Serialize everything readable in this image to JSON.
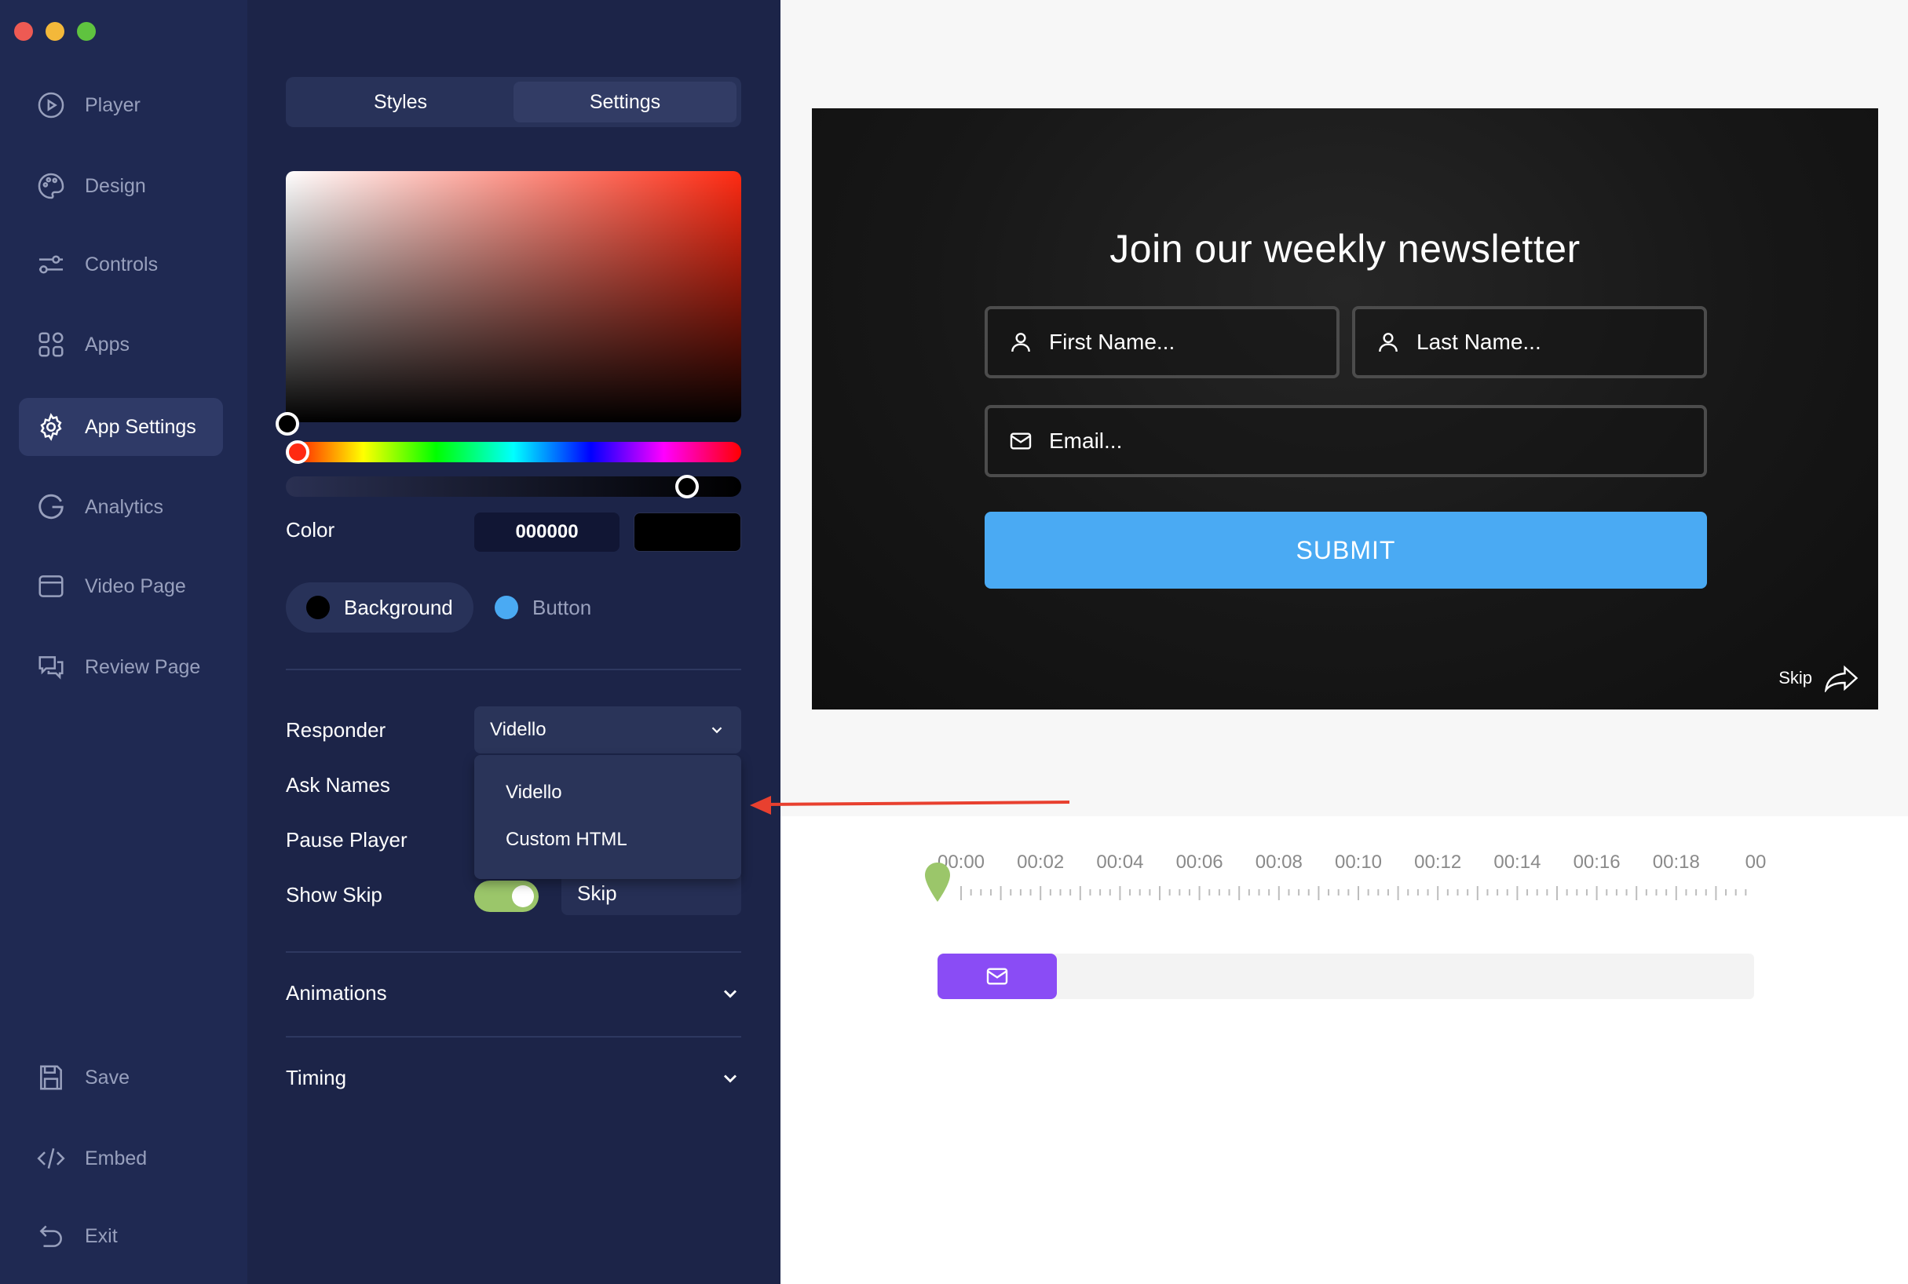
{
  "window": {
    "traffic_lights": [
      "#ee5a53",
      "#f3b83a",
      "#5fc33f"
    ]
  },
  "nav": {
    "items": [
      {
        "label": "Player",
        "icon": "play-circle-icon"
      },
      {
        "label": "Design",
        "icon": "palette-icon"
      },
      {
        "label": "Controls",
        "icon": "sliders-icon"
      },
      {
        "label": "Apps",
        "icon": "apps-grid-icon"
      },
      {
        "label": "App Settings",
        "icon": "gear-icon",
        "active": true
      },
      {
        "label": "Analytics",
        "icon": "analytics-g-icon"
      },
      {
        "label": "Video Page",
        "icon": "browser-window-icon"
      },
      {
        "label": "Review Page",
        "icon": "chat-bubbles-icon"
      }
    ],
    "bottom": [
      {
        "label": "Save",
        "icon": "floppy-disk-icon"
      },
      {
        "label": "Embed",
        "icon": "code-icon"
      },
      {
        "label": "Exit",
        "icon": "undo-arrow-icon"
      }
    ]
  },
  "panel": {
    "tabs": {
      "styles": "Styles",
      "settings": "Settings",
      "active": "settings"
    },
    "picker": {
      "hue_color": "#ff2a12"
    },
    "color": {
      "label": "Color",
      "hex": "000000",
      "swatch": "#000000"
    },
    "targets": {
      "background": {
        "label": "Background",
        "dot": "#000000",
        "active": true
      },
      "button": {
        "label": "Button",
        "dot": "#4aaaf3"
      }
    },
    "responder": {
      "label": "Responder",
      "value": "Vidello",
      "options": [
        "Vidello",
        "Custom HTML"
      ]
    },
    "ask_names": {
      "label": "Ask Names"
    },
    "pause_player": {
      "label": "Pause Player"
    },
    "show_skip": {
      "label": "Show Skip",
      "on": true,
      "text": "Skip"
    },
    "animations": {
      "label": "Animations"
    },
    "timing": {
      "label": "Timing"
    }
  },
  "preview": {
    "title": "Join our weekly newsletter",
    "first_name": {
      "placeholder": "First Name..."
    },
    "last_name": {
      "placeholder": "Last Name..."
    },
    "email": {
      "placeholder": "Email..."
    },
    "submit": "SUBMIT",
    "skip": "Skip",
    "button_color": "#4aaaf3"
  },
  "timeline": {
    "ticks": [
      "00:00",
      "00:02",
      "00:04",
      "00:06",
      "00:08",
      "00:10",
      "00:12",
      "00:14",
      "00:16",
      "00:18",
      "00"
    ],
    "marker_color": "#9bc66a",
    "clip_color": "#8a4cf5",
    "clip_icon": "mail-icon"
  },
  "annotation": {
    "arrow_color": "#e8402f"
  }
}
